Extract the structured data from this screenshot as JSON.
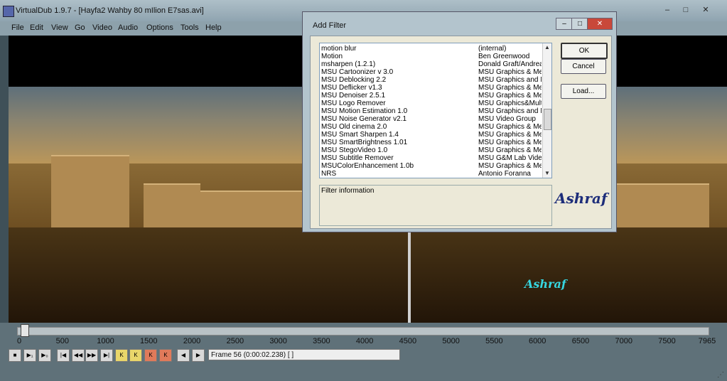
{
  "window": {
    "title": "VirtualDub 1.9.7 - [Hayfa2 Wahby 80 mIlion E7sas.avi]",
    "controls": [
      "–",
      "□",
      "✕"
    ]
  },
  "menu": [
    "File",
    "Edit",
    "View",
    "Go",
    "Video",
    "Audio",
    "Options",
    "Tools",
    "Help"
  ],
  "watermarks": {
    "dialog": "Ashraf",
    "video": "Ashraf"
  },
  "timeline": {
    "ticks": [
      "0",
      "500",
      "1000",
      "1500",
      "2000",
      "2500",
      "3000",
      "3500",
      "4000",
      "4500",
      "5000",
      "5500",
      "6000",
      "6500",
      "7000",
      "7500",
      "7965"
    ],
    "position_fraction": 0.007
  },
  "status": {
    "frame": "Frame 56 (0:00:02.238) [ ]"
  },
  "dialog": {
    "title": "Add Filter",
    "info_label": "Filter information",
    "buttons": {
      "ok": "OK",
      "cancel": "Cancel",
      "load": "Load..."
    },
    "filters": [
      {
        "name": "motion blur",
        "author": "(internal)"
      },
      {
        "name": "Motion",
        "author": "Ben Greenwood"
      },
      {
        "name": "msharpen (1.2.1)",
        "author": "Donald Graft/Andreas"
      },
      {
        "name": "MSU Cartoonizer v 3.0",
        "author": "MSU Graphics & Medi"
      },
      {
        "name": "MSU Deblocking 2.2",
        "author": "MSU Graphics and M"
      },
      {
        "name": "MSU Deflicker v1.3",
        "author": "MSU Graphics & Medi"
      },
      {
        "name": "MSU Denoiser 2.5.1",
        "author": "MSU Graphics & Medi"
      },
      {
        "name": "MSU Logo Remover",
        "author": "MSU Graphics&Multim"
      },
      {
        "name": "MSU Motion Estimation 1.0",
        "author": "MSU Graphics and M"
      },
      {
        "name": "MSU Noise Generator v2.1",
        "author": "MSU Video Group"
      },
      {
        "name": "MSU Old cinema 2.0",
        "author": "MSU Graphics & Medi"
      },
      {
        "name": "MSU Smart Sharpen 1.4",
        "author": "MSU Graphics & Medi"
      },
      {
        "name": "MSU SmartBrightness 1.01",
        "author": "MSU Graphics & Medi"
      },
      {
        "name": "MSU StegoVideo 1.0",
        "author": "MSU Graphics & Medi"
      },
      {
        "name": "MSU Subtitle Remover",
        "author": "MSU G&M Lab Video"
      },
      {
        "name": "MSUColorEnhancement 1.0b",
        "author": "MSU Graphics & Medi"
      },
      {
        "name": "NRS",
        "author": "Antonio Foranna"
      }
    ]
  },
  "toolbar": [
    "■",
    "▶₁",
    "▶₀",
    "|◀",
    "◀◀",
    "▶▶",
    "▶|",
    "K",
    "K",
    "K",
    "K",
    "◀",
    "▶"
  ]
}
